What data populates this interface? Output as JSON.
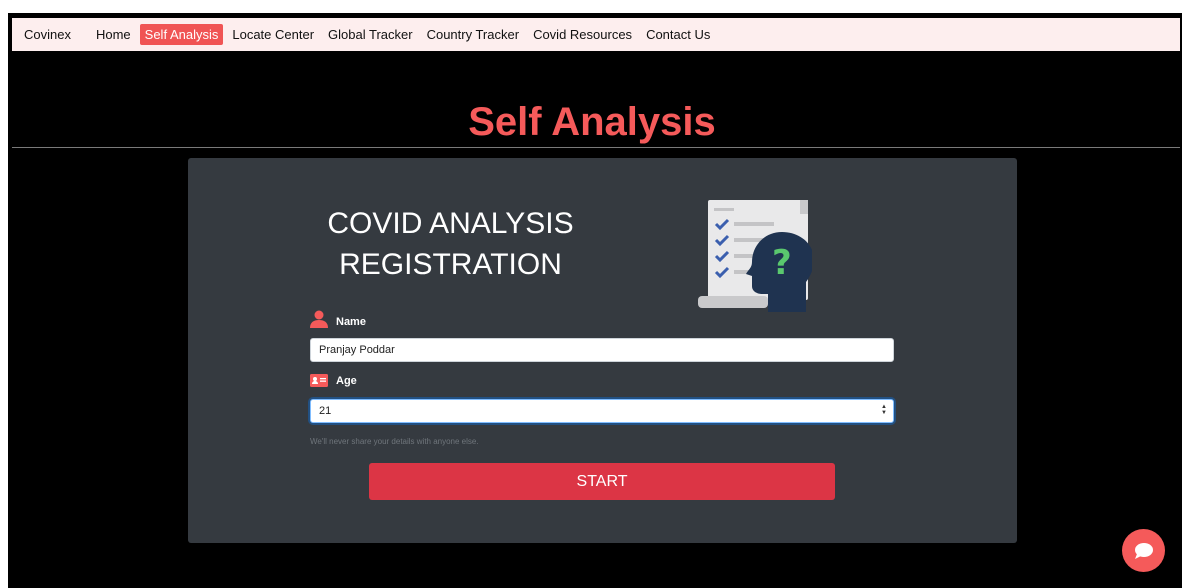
{
  "nav": {
    "brand": "Covinex",
    "items": [
      {
        "label": "Home",
        "active": false
      },
      {
        "label": "Self Analysis",
        "active": true
      },
      {
        "label": "Locate Center",
        "active": false
      },
      {
        "label": "Global Tracker",
        "active": false
      },
      {
        "label": "Country Tracker",
        "active": false
      },
      {
        "label": "Covid Resources",
        "active": false
      },
      {
        "label": "Contact Us",
        "active": false
      }
    ]
  },
  "page": {
    "title": "Self Analysis"
  },
  "form": {
    "heading_line1": "COVID ANALYSIS",
    "heading_line2": "REGISTRATION",
    "name_label": "Name",
    "name_value": "Pranjay Poddar",
    "age_label": "Age",
    "age_value": "21",
    "helper_text": "We'll never share your details with anyone else.",
    "start_label": "START"
  },
  "colors": {
    "accent": "#f55a5a",
    "start_button": "#dc3545",
    "card": "#353a40",
    "nav_bg": "#fdeeee"
  },
  "icons": {
    "name": "user-icon",
    "age": "id-card-icon",
    "illustration": "checklist-head-question-icon",
    "chat": "chat-bubble-icon"
  }
}
